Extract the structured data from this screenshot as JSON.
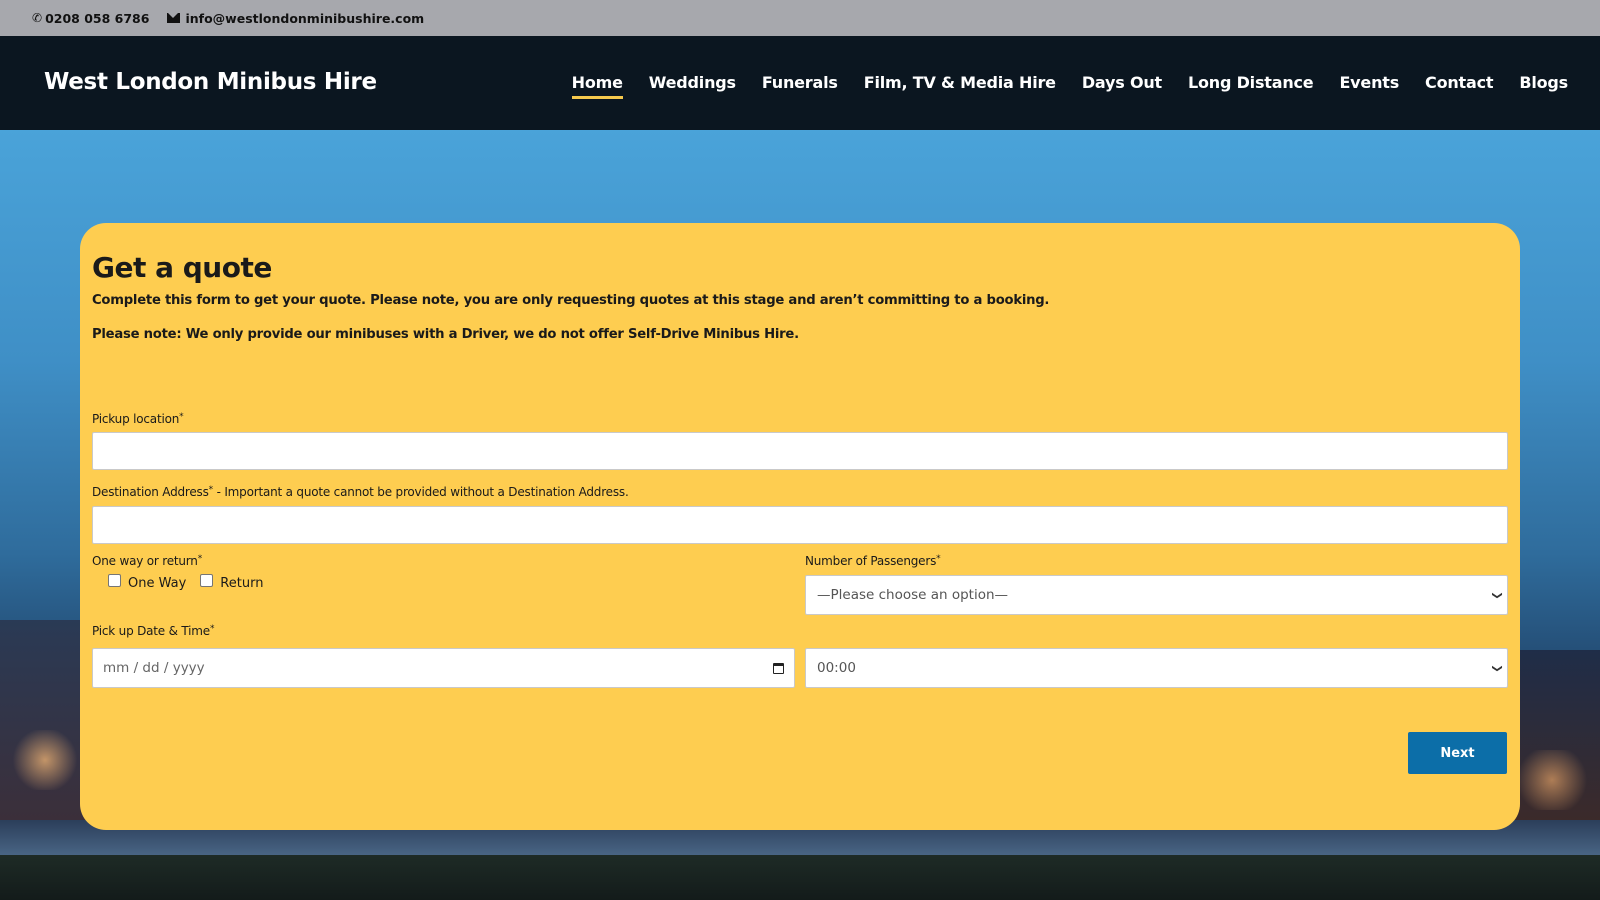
{
  "topbar": {
    "phone": "0208 058 6786",
    "email": "info@westlondonminibushire.com",
    "phone_icon": "phone-icon",
    "email_icon": "envelope-icon"
  },
  "header": {
    "logo": "West London Minibus Hire",
    "nav": [
      {
        "label": "Home",
        "active": true
      },
      {
        "label": "Weddings"
      },
      {
        "label": "Funerals"
      },
      {
        "label": "Film, TV & Media Hire"
      },
      {
        "label": "Days Out"
      },
      {
        "label": "Long Distance"
      },
      {
        "label": "Events"
      },
      {
        "label": "Contact"
      },
      {
        "label": "Blogs"
      }
    ]
  },
  "form": {
    "title": "Get a quote",
    "intro1": "Complete this form to get your quote. Please note, you are only requesting quotes at this stage and aren’t committing to a booking.",
    "intro2": "Please note: We only provide our minibuses with a Driver, we do not offer Self-Drive Minibus Hire.",
    "pickup_label": "Pickup location",
    "pickup_value": "",
    "destination_label": "Destination Address",
    "destination_note": " - Important a quote cannot be provided without a Destination Address.",
    "destination_value": "",
    "trip_label": "One way or return",
    "trip_options": [
      "One Way",
      "Return"
    ],
    "passengers_label": "Number of Passengers",
    "passengers_value": "—Please choose an option—",
    "datetime_label": "Pick up Date & Time",
    "date_placeholder": "mm / dd / yyyy",
    "time_value": "00:00",
    "required_mark": "*",
    "next_button": "Next"
  },
  "colors": {
    "card": "#fecd50",
    "header": "#0b1620",
    "topbar": "#a7a8ad",
    "button": "#0c6ea8",
    "nav_active_underline": "#f6c94d"
  }
}
